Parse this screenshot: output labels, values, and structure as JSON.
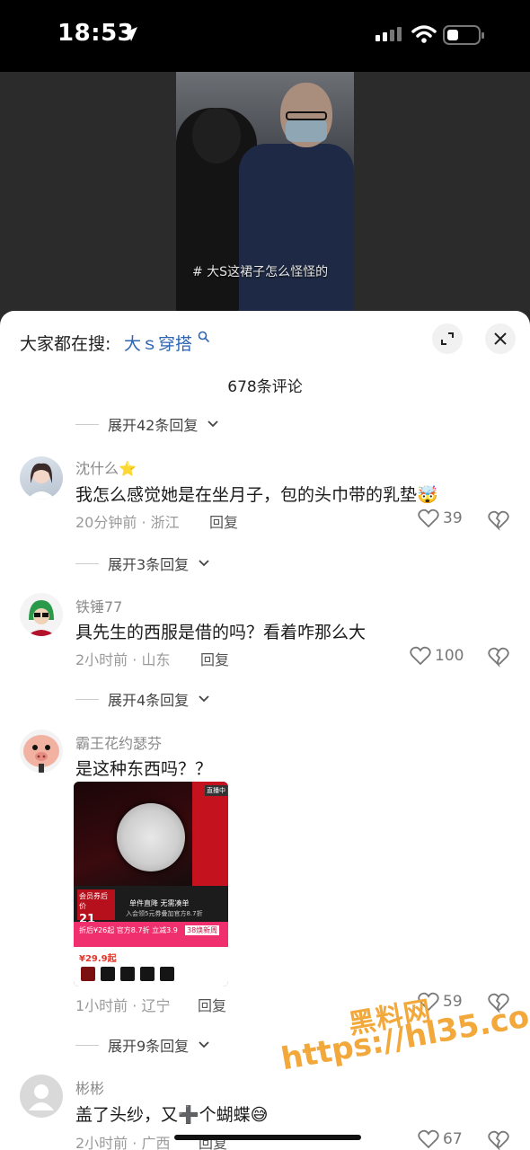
{
  "status_bar": {
    "time": "18:53"
  },
  "video": {
    "caption": "# 大S这裙子怎么怪怪的"
  },
  "sheet": {
    "search_prefix": "大家都在搜:",
    "search_term": "大ｓ穿搭",
    "comment_count": "678条评论"
  },
  "expanders": [
    {
      "label": "展开42条回复"
    },
    {
      "label": "展开3条回复"
    },
    {
      "label": "展开4条回复"
    },
    {
      "label": "展开9条回复"
    }
  ],
  "comments": [
    {
      "username": "沈什么⭐",
      "text": "我怎么感觉她是在坐月子，包的头巾带的乳垫🤯",
      "meta": "20分钟前 · 浙江",
      "reply": "回复",
      "likes": "39"
    },
    {
      "username": "铁锤77",
      "text": "具先生的西服是借的吗？看着咋那么大",
      "meta": "2小时前 · 山东",
      "reply": "回复",
      "likes": "100"
    },
    {
      "username": "霸王花约瑟芬",
      "text": "是这种东西吗？？",
      "meta": "1小时前 · 辽宁",
      "reply": "回复",
      "likes": "59"
    },
    {
      "username": "彬彬",
      "text": "盖了头纱，又➕个蝴蝶😅",
      "meta": "2小时前 · 广西",
      "reply": "回复",
      "likes": "67"
    }
  ],
  "comment_image": {
    "badge": "直播中",
    "member_price_label": "会员券后价",
    "member_price": "21",
    "slogan": "单件直降 无需凑单",
    "slogan_sub": "入会领5元券叠加官方8.7折",
    "promo_left": "折后¥26起 官方8.7折 立减3.9",
    "promo_right": "38焕新周",
    "price": "¥29.9起"
  },
  "watermark": {
    "line1": "黑料网",
    "line2": "https://hl35.co"
  }
}
